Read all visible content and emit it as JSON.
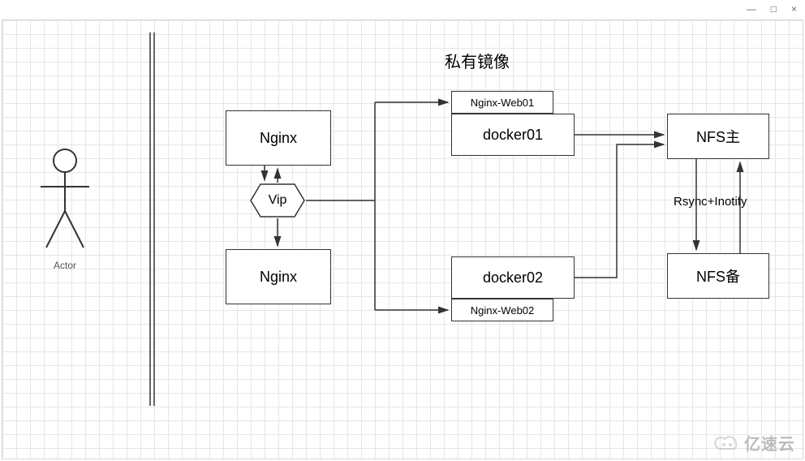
{
  "window": {
    "min": "—",
    "max": "□",
    "close": "×"
  },
  "diagram": {
    "title": "私有镜像",
    "actor_label": "Actor",
    "nginx1": "Nginx",
    "nginx2": "Nginx",
    "vip": "Vip",
    "web1_label": "Nginx-Web01",
    "docker1": "docker01",
    "docker2": "docker02",
    "web2_label": "Nginx-Web02",
    "nfs_master": "NFS主",
    "nfs_backup": "NFS备",
    "sync_label": "Rsync+Inotify"
  },
  "watermark": "亿速云"
}
